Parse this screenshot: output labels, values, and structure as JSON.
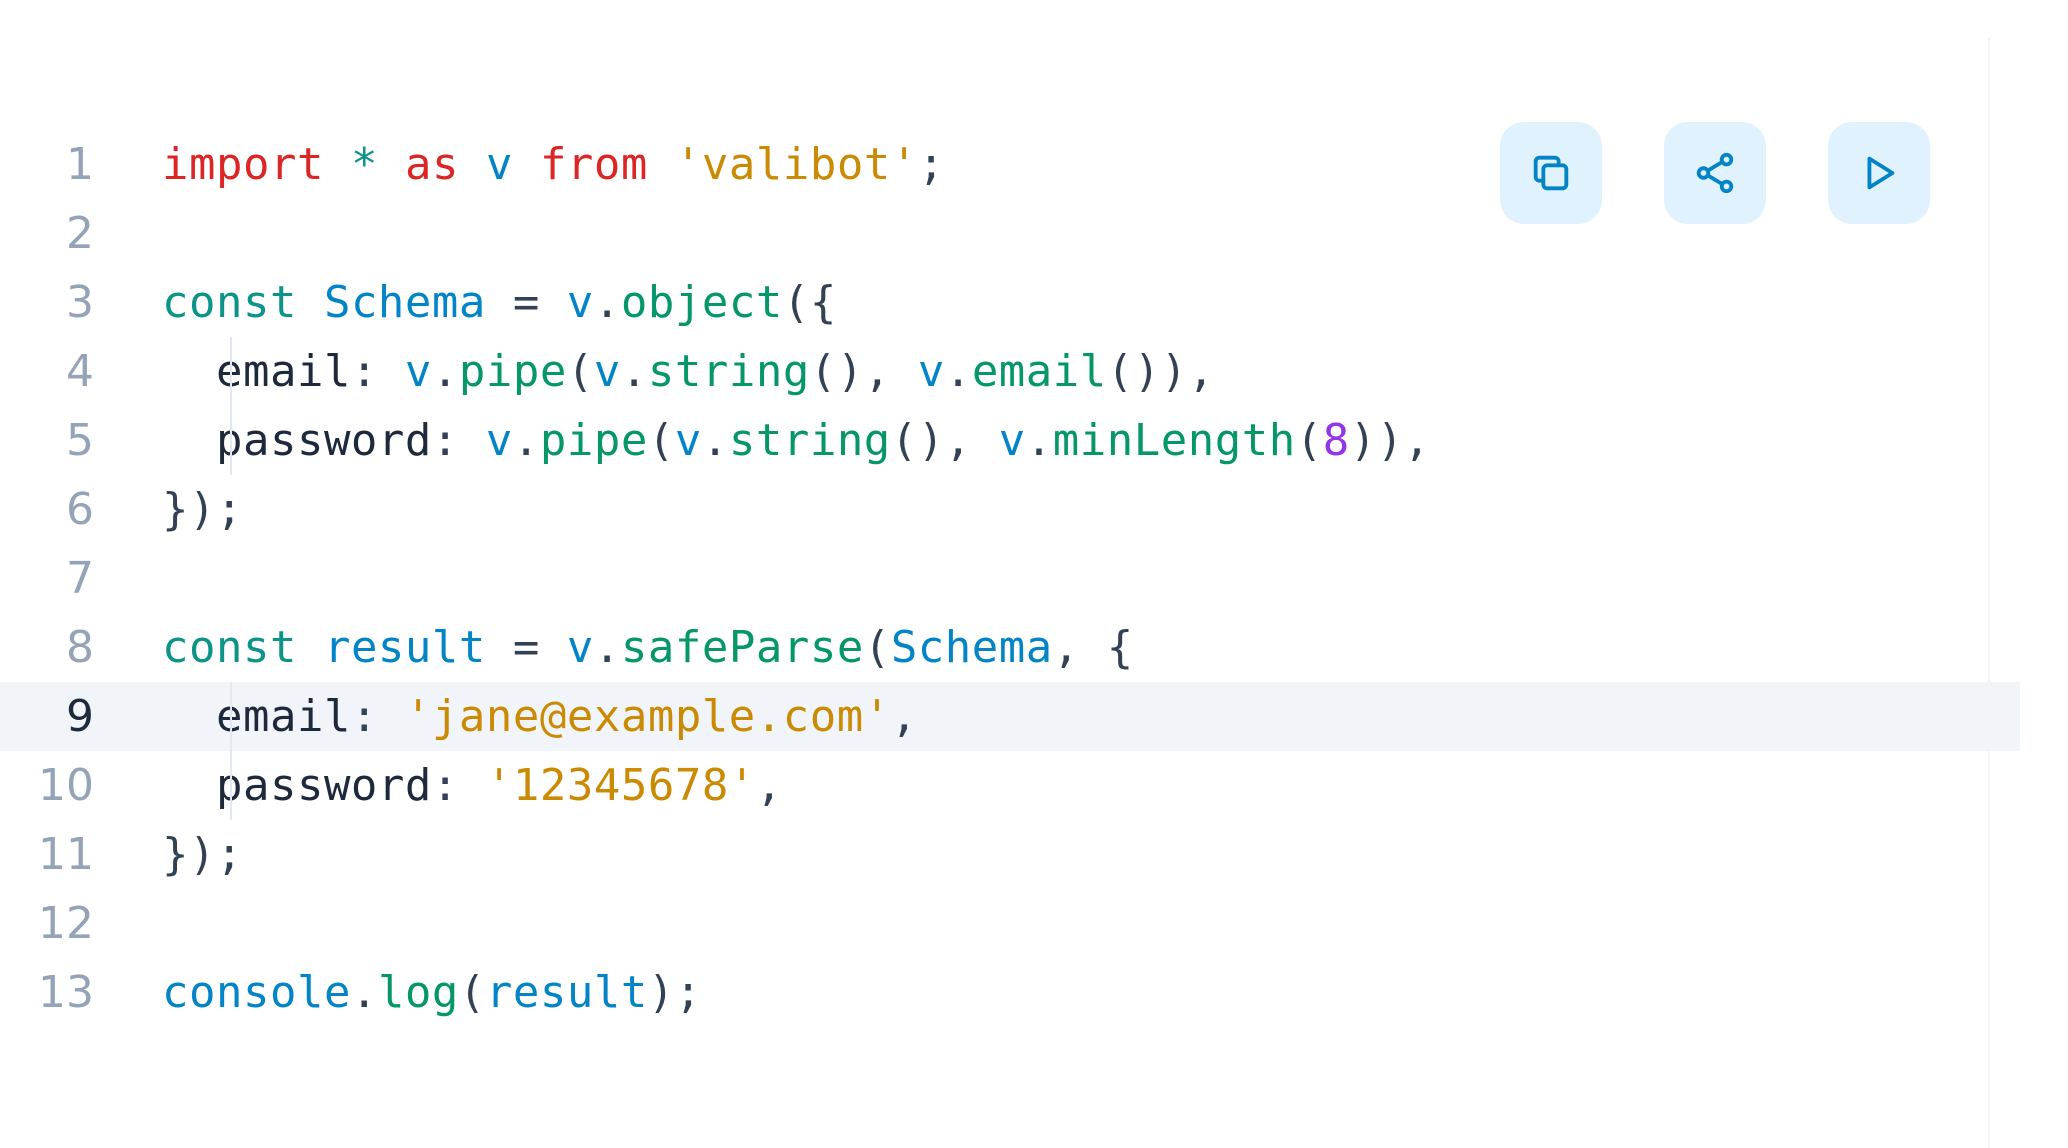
{
  "editor": {
    "active_line": 9,
    "lines": [
      {
        "num": "1",
        "tokens": [
          {
            "t": "import",
            "c": "kw"
          },
          {
            "t": " ",
            "c": "pun"
          },
          {
            "t": "*",
            "c": "kw2"
          },
          {
            "t": " ",
            "c": "pun"
          },
          {
            "t": "as",
            "c": "kw"
          },
          {
            "t": " ",
            "c": "pun"
          },
          {
            "t": "v",
            "c": "id"
          },
          {
            "t": " ",
            "c": "pun"
          },
          {
            "t": "from",
            "c": "kw"
          },
          {
            "t": " ",
            "c": "pun"
          },
          {
            "t": "'valibot'",
            "c": "str"
          },
          {
            "t": ";",
            "c": "pun"
          }
        ]
      },
      {
        "num": "2",
        "tokens": []
      },
      {
        "num": "3",
        "tokens": [
          {
            "t": "const",
            "c": "kw2"
          },
          {
            "t": " ",
            "c": "pun"
          },
          {
            "t": "Schema",
            "c": "id"
          },
          {
            "t": " = ",
            "c": "pun"
          },
          {
            "t": "v",
            "c": "id"
          },
          {
            "t": ".",
            "c": "pun"
          },
          {
            "t": "object",
            "c": "fn"
          },
          {
            "t": "({",
            "c": "pun"
          }
        ]
      },
      {
        "num": "4",
        "indent": true,
        "tokens": [
          {
            "t": "  email",
            "c": "prop"
          },
          {
            "t": ": ",
            "c": "pun"
          },
          {
            "t": "v",
            "c": "id"
          },
          {
            "t": ".",
            "c": "pun"
          },
          {
            "t": "pipe",
            "c": "fn"
          },
          {
            "t": "(",
            "c": "pun"
          },
          {
            "t": "v",
            "c": "id"
          },
          {
            "t": ".",
            "c": "pun"
          },
          {
            "t": "string",
            "c": "fn"
          },
          {
            "t": "(), ",
            "c": "pun"
          },
          {
            "t": "v",
            "c": "id"
          },
          {
            "t": ".",
            "c": "pun"
          },
          {
            "t": "email",
            "c": "fn"
          },
          {
            "t": "()),",
            "c": "pun"
          }
        ]
      },
      {
        "num": "5",
        "indent": true,
        "tokens": [
          {
            "t": "  password",
            "c": "prop"
          },
          {
            "t": ": ",
            "c": "pun"
          },
          {
            "t": "v",
            "c": "id"
          },
          {
            "t": ".",
            "c": "pun"
          },
          {
            "t": "pipe",
            "c": "fn"
          },
          {
            "t": "(",
            "c": "pun"
          },
          {
            "t": "v",
            "c": "id"
          },
          {
            "t": ".",
            "c": "pun"
          },
          {
            "t": "string",
            "c": "fn"
          },
          {
            "t": "(), ",
            "c": "pun"
          },
          {
            "t": "v",
            "c": "id"
          },
          {
            "t": ".",
            "c": "pun"
          },
          {
            "t": "minLength",
            "c": "fn"
          },
          {
            "t": "(",
            "c": "pun"
          },
          {
            "t": "8",
            "c": "num"
          },
          {
            "t": ")),",
            "c": "pun"
          }
        ]
      },
      {
        "num": "6",
        "tokens": [
          {
            "t": "});",
            "c": "pun"
          }
        ]
      },
      {
        "num": "7",
        "tokens": []
      },
      {
        "num": "8",
        "tokens": [
          {
            "t": "const",
            "c": "kw2"
          },
          {
            "t": " ",
            "c": "pun"
          },
          {
            "t": "result",
            "c": "id"
          },
          {
            "t": " = ",
            "c": "pun"
          },
          {
            "t": "v",
            "c": "id"
          },
          {
            "t": ".",
            "c": "pun"
          },
          {
            "t": "safeParse",
            "c": "fn"
          },
          {
            "t": "(",
            "c": "pun"
          },
          {
            "t": "Schema",
            "c": "id"
          },
          {
            "t": ", {",
            "c": "pun"
          }
        ]
      },
      {
        "num": "9",
        "indent": true,
        "tokens": [
          {
            "t": "  email",
            "c": "prop"
          },
          {
            "t": ": ",
            "c": "pun"
          },
          {
            "t": "'jane@example.com'",
            "c": "str"
          },
          {
            "t": ",",
            "c": "pun"
          }
        ]
      },
      {
        "num": "10",
        "indent": true,
        "tokens": [
          {
            "t": "  password",
            "c": "prop"
          },
          {
            "t": ": ",
            "c": "pun"
          },
          {
            "t": "'12345678'",
            "c": "str"
          },
          {
            "t": ",",
            "c": "pun"
          }
        ]
      },
      {
        "num": "11",
        "tokens": [
          {
            "t": "});",
            "c": "pun"
          }
        ]
      },
      {
        "num": "12",
        "tokens": []
      },
      {
        "num": "13",
        "tokens": [
          {
            "t": "console",
            "c": "id"
          },
          {
            "t": ".",
            "c": "pun"
          },
          {
            "t": "log",
            "c": "fn"
          },
          {
            "t": "(",
            "c": "pun"
          },
          {
            "t": "result",
            "c": "id"
          },
          {
            "t": ");",
            "c": "pun"
          }
        ]
      }
    ]
  },
  "toolbar": {
    "buttons": [
      {
        "name": "copy-button",
        "icon": "copy-icon"
      },
      {
        "name": "share-button",
        "icon": "share-icon"
      },
      {
        "name": "run-button",
        "icon": "play-icon"
      }
    ]
  },
  "colors": {
    "keyword": "#dc2626",
    "keyword_alt": "#0d9488",
    "identifier": "#0284c7",
    "function": "#059669",
    "string": "#ca8a04",
    "number": "#9333ea",
    "button_bg": "#e0f2fe",
    "icon": "#0284c7",
    "active_line_bg": "#f1f5f9"
  }
}
